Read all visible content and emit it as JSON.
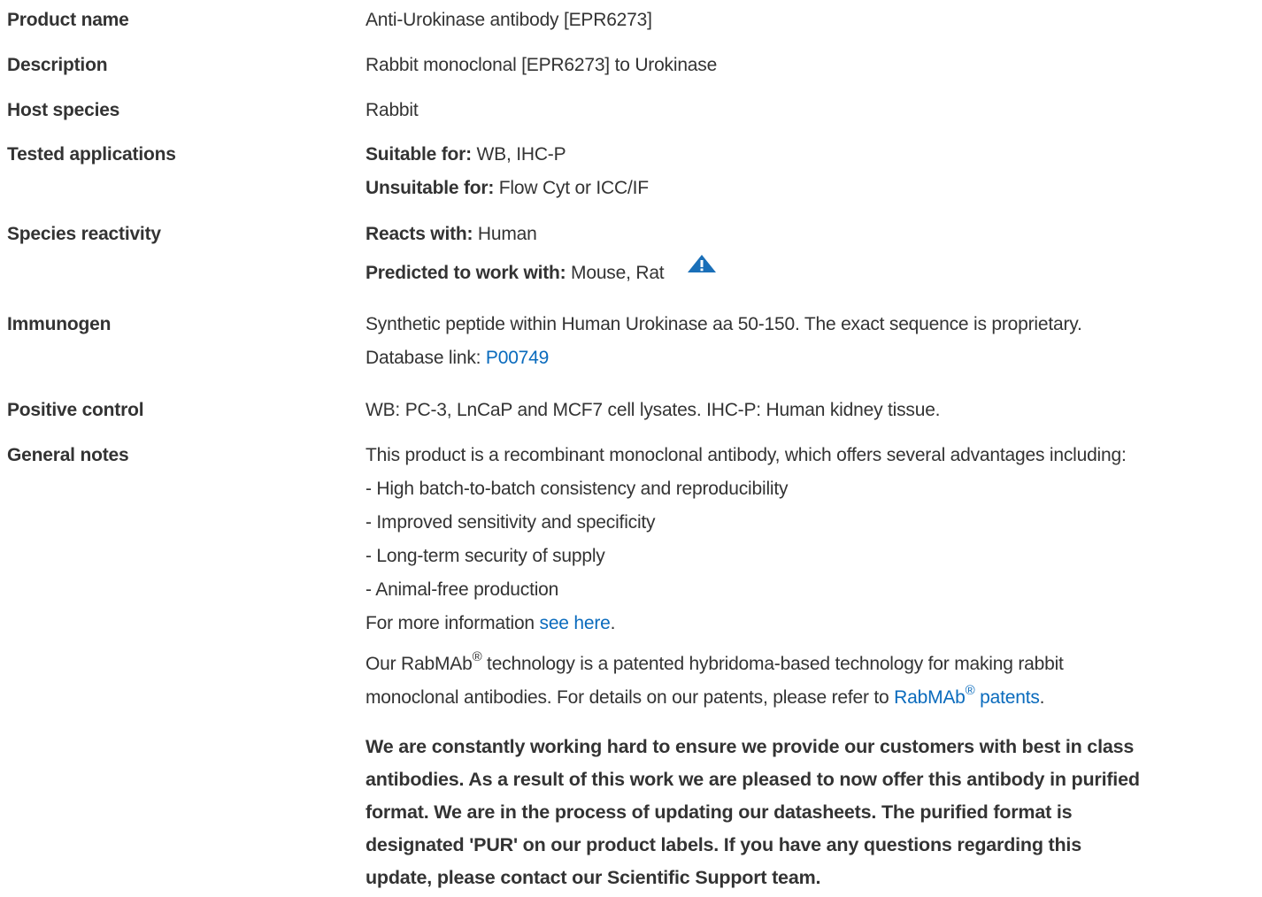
{
  "product_name": {
    "label": "Product name",
    "value": "Anti-Urokinase antibody [EPR6273]"
  },
  "description": {
    "label": "Description",
    "value": "Rabbit monoclonal [EPR6273] to Urokinase"
  },
  "host_species": {
    "label": "Host species",
    "value": "Rabbit"
  },
  "tested_applications": {
    "label": "Tested applications",
    "suitable_label": "Suitable for:",
    "suitable_value": " WB, IHC-P",
    "unsuitable_label": "Unsuitable for:",
    "unsuitable_value": " Flow Cyt or ICC/IF"
  },
  "species_reactivity": {
    "label": "Species reactivity",
    "reacts_label": "Reacts with:",
    "reacts_value": " Human",
    "predicted_label": "Predicted to work with:",
    "predicted_value": " Mouse, Rat",
    "warning_icon": "warning-triangle-icon"
  },
  "immunogen": {
    "label": "Immunogen",
    "value": "Synthetic peptide within Human Urokinase aa 50-150. The exact sequence is proprietary.",
    "db_prefix": "Database link: ",
    "db_link": "P00749"
  },
  "positive_control": {
    "label": "Positive control",
    "value": "WB: PC-3, LnCaP and MCF7 cell lysates. IHC-P: Human kidney tissue."
  },
  "general_notes": {
    "label": "General notes",
    "intro": "This product is a recombinant monoclonal antibody, which offers several advantages including:",
    "bullets": [
      "- High batch-to-batch consistency and reproducibility",
      "- Improved sensitivity and specificity",
      "- Long-term security of supply",
      "- Animal-free production"
    ],
    "more_info_prefix": "For more information ",
    "more_info_link": "see here",
    "more_info_suffix": ".",
    "rabmab_word": "RabMAb",
    "registered": "®",
    "rabmab_text1": " technology is a patented hybridoma-based technology for making rabbit",
    "rabmab_prefix": "Our ",
    "rabmab_text2": "monoclonal antibodies. For details on our patents, please refer to ",
    "rabmab_link_word": "RabMAb",
    "rabmab_link_rest": " patents",
    "rabmab_end": ".",
    "bold_lines": [
      "We are constantly working hard to ensure we provide our customers with best in class",
      "antibodies. As a result of this work we are pleased to now offer this antibody in purified",
      "format. We are in the process of updating our datasheets. The purified format is",
      "designated 'PUR' on our product labels. If you have any questions regarding this",
      "update, please contact our Scientific Support team."
    ]
  },
  "colors": {
    "text": "#333333",
    "link": "#0a6bbd",
    "icon": "#1a6fb8"
  }
}
